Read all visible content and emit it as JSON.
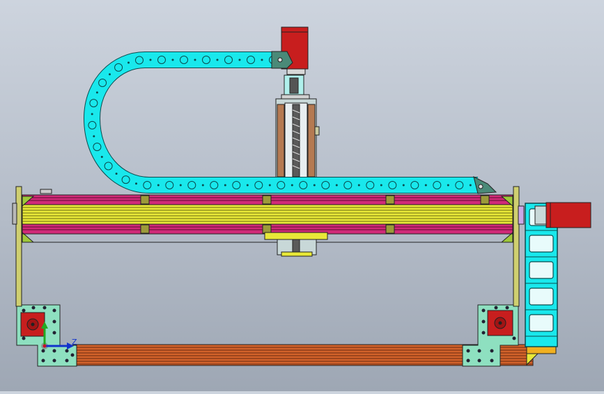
{
  "viewport": {
    "name": "cad-model-view",
    "background_top": "#cdd4de",
    "background_bottom": "#9ea7b4"
  },
  "triad": {
    "z_label": "Z",
    "axis_colors": {
      "x": "#c8102e",
      "y": "#22aa22",
      "z": "#1133cc"
    }
  },
  "colors": {
    "cable_chain": "#19e8ec",
    "cable_chain_outline": "#0a4b4e",
    "motor": "#c81e1e",
    "gantry_yellow": "#e8e838",
    "gantry_magenta": "#d02a78",
    "gantry_green": "#9ec83a",
    "bracket_mint": "#8ee0c0",
    "base_rail": "#d2622a",
    "z_plate_brown": "#b57a52",
    "leadscrew": "#5a5a5a",
    "lavender": "#c9a8e6",
    "orange_block": "#f0b020"
  },
  "components": [
    "z-axis-stepper-motor",
    "z-axis-carriage",
    "x-gantry-beam",
    "x-cable-chain",
    "y-cable-chain",
    "x-axis-stepper-motor",
    "left-y-stepper-motor",
    "right-y-stepper-motor",
    "base-rail"
  ]
}
